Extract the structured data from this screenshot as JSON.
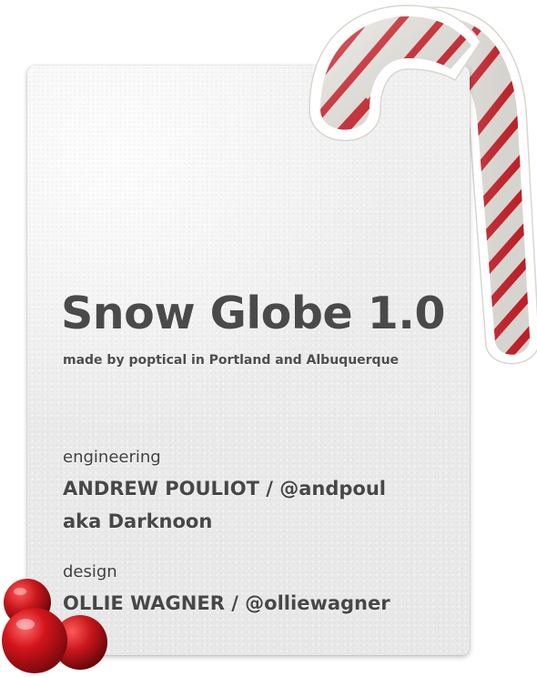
{
  "app": {
    "title": "Snow Globe 1.0",
    "subtitle": "made by poptical in Portland and Albuquerque"
  },
  "credits": {
    "engineering": {
      "label": "engineering",
      "name": "ANDREW POULIOT / @andpoul",
      "alias": "aka Darknoon"
    },
    "design": {
      "label": "design",
      "name": "OLLIE WAGNER / @olliewagner"
    }
  },
  "decorations": {
    "candy_cane_icon": "candy-cane-icon",
    "ornament_icon": "ornament-icon",
    "colors": {
      "stripe_red": "#d8202a",
      "cane_white": "#f7f4ee",
      "ornament_red": "#c8171c",
      "card": "#eeeeee",
      "text": "#4a4a4a"
    }
  }
}
